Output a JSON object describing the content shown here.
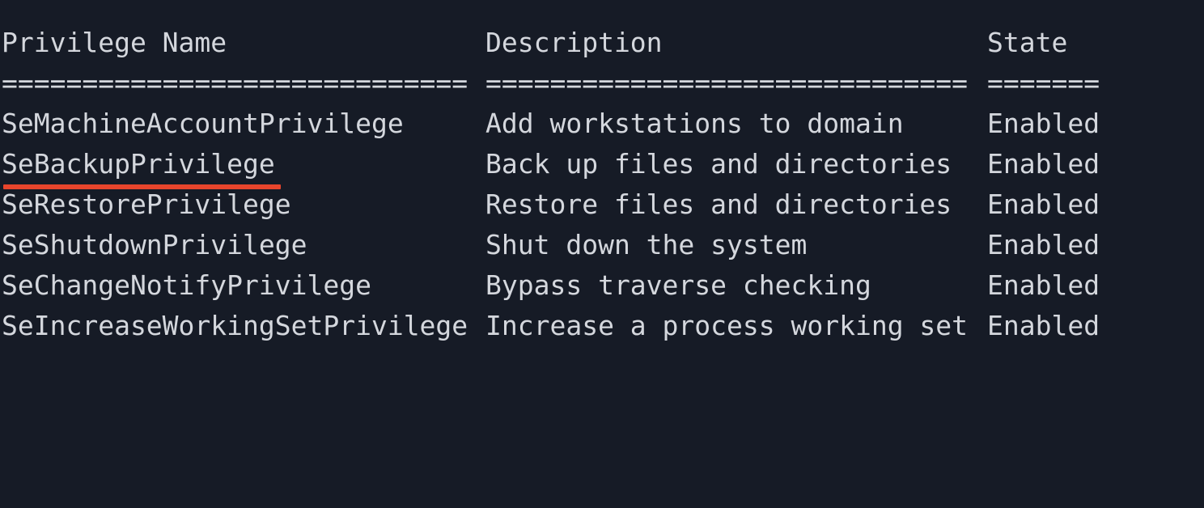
{
  "table": {
    "headers": {
      "name": "Privilege Name",
      "description": "Description",
      "state": "State"
    },
    "separators": {
      "name": "=============================",
      "description": "==============================",
      "state": "======="
    },
    "rows": [
      {
        "name": "SeMachineAccountPrivilege",
        "description": "Add workstations to domain",
        "state": "Enabled"
      },
      {
        "name": "SeBackupPrivilege",
        "description": "Back up files and directories",
        "state": "Enabled"
      },
      {
        "name": "SeRestorePrivilege",
        "description": "Restore files and directories",
        "state": "Enabled"
      },
      {
        "name": "SeShutdownPrivilege",
        "description": "Shut down the system",
        "state": "Enabled"
      },
      {
        "name": "SeChangeNotifyPrivilege",
        "description": "Bypass traverse checking",
        "state": "Enabled"
      },
      {
        "name": "SeIncreaseWorkingSetPrivilege",
        "description": "Increase a process working set",
        "state": "Enabled"
      }
    ]
  },
  "highlight": {
    "row_name": "SeBackupPrivilege",
    "color": "#e8452c"
  },
  "colors": {
    "background": "#161b26",
    "text": "#d4d7dd"
  }
}
